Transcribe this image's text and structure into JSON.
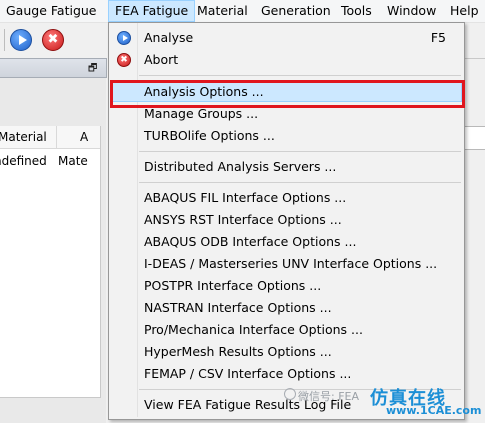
{
  "menubar": {
    "items": [
      {
        "label": "Gauge Fatigue"
      },
      {
        "label": "FEA Fatigue"
      },
      {
        "label": "Material"
      },
      {
        "label": "Generation"
      },
      {
        "label": "Tools"
      },
      {
        "label": "Window"
      },
      {
        "label": "Help"
      }
    ],
    "active": "FEA Fatigue"
  },
  "toolbar": {
    "run_icon": "run-icon",
    "stop_icon": "stop-icon",
    "stop_glyph": "✖"
  },
  "left_panel": {
    "float_glyph": "🗗",
    "columns": [
      "Material",
      "A"
    ],
    "row": [
      "ndefined",
      "Mate"
    ]
  },
  "menu": {
    "items": [
      {
        "label": "Analyse",
        "shortcut": "F5",
        "icon": "run-icon"
      },
      {
        "label": "Abort",
        "icon": "stop-icon",
        "icon_glyph": "✖"
      },
      {
        "label": "Analysis Options ..."
      },
      {
        "label": "Manage Groups ..."
      },
      {
        "label": "TURBOlife Options ..."
      },
      {
        "label": "Distributed Analysis Servers ..."
      },
      {
        "label": "ABAQUS FIL Interface Options ..."
      },
      {
        "label": "ANSYS RST Interface Options ..."
      },
      {
        "label": "ABAQUS ODB Interface Options ..."
      },
      {
        "label": "I-DEAS / Masterseries UNV Interface Options ..."
      },
      {
        "label": "POSTPR Interface Options ..."
      },
      {
        "label": "NASTRAN Interface Options ..."
      },
      {
        "label": "Pro/Mechanica Interface Options ..."
      },
      {
        "label": "HyperMesh Results Options ..."
      },
      {
        "label": "FEMAP / CSV Interface Options ..."
      },
      {
        "label": "View FEA Fatigue Results Log File"
      }
    ],
    "highlighted": "Analysis Options ..."
  },
  "watermark": {
    "account": "微信号: FEA",
    "brand": "仿真在线",
    "site": "www.1CAE.com"
  },
  "colors": {
    "highlight_bg": "#cce8ff",
    "annotation_box": "#e0161e",
    "brand_blue": "#1c8fd6"
  }
}
